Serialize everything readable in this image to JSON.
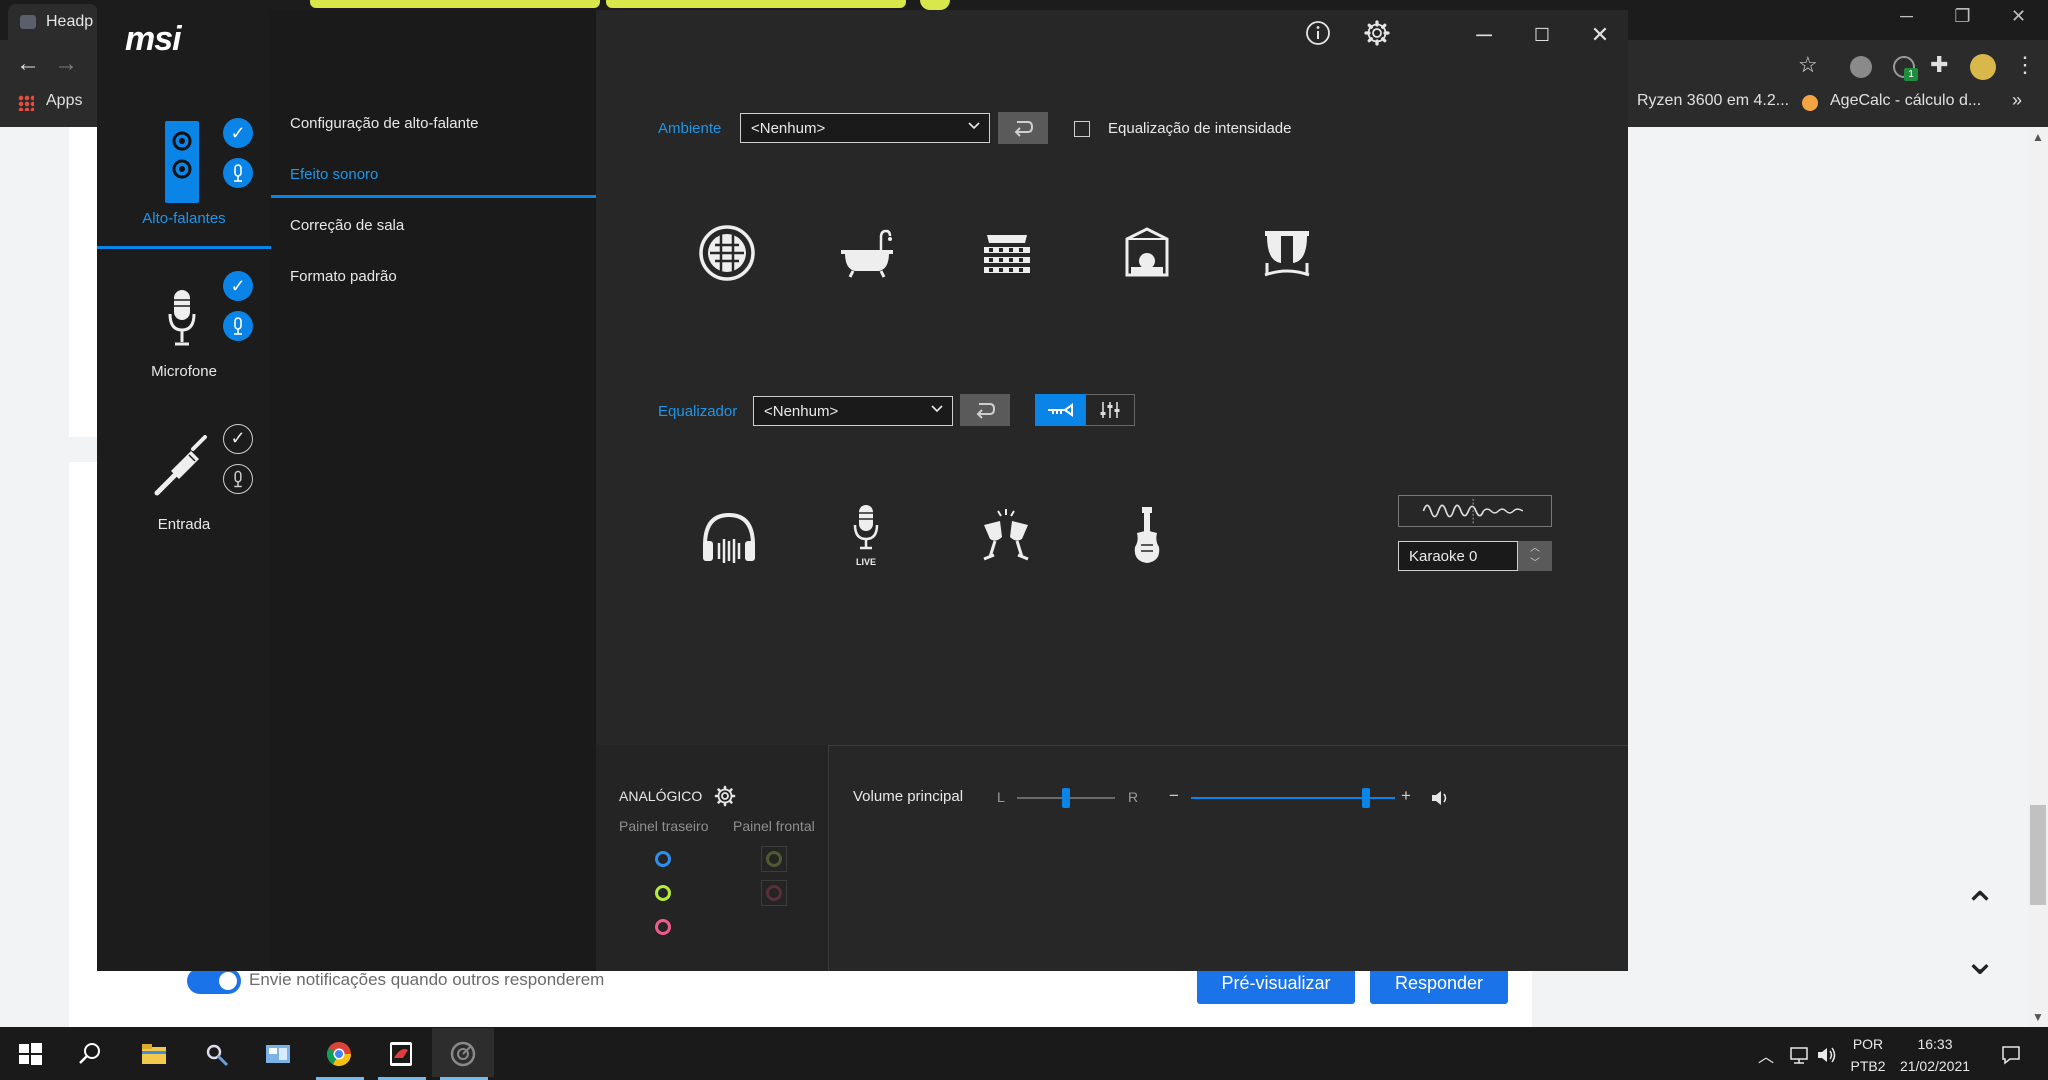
{
  "browser": {
    "tab_title": "Headp",
    "bookmarks": {
      "apps_label": "Apps",
      "ryzen_label": "Ryzen 3600 em 4.2...",
      "agecalc_label": "AgeCalc - cálculo d..."
    },
    "more_bookmarks": "»",
    "ext_count": "1"
  },
  "page": {
    "notify_label": "Envie notificações quando outros responderem",
    "preview_button": "Pré-visualizar",
    "reply_button": "Responder"
  },
  "app": {
    "logo": "msi",
    "devices": [
      {
        "label": "Alto-falantes"
      },
      {
        "label": "Microfone"
      },
      {
        "label": "Entrada"
      }
    ],
    "menu": [
      {
        "label": "Configuração de alto-falante"
      },
      {
        "label": "Efeito sonoro"
      },
      {
        "label": "Correção de sala"
      },
      {
        "label": "Formato padrão"
      }
    ],
    "environment": {
      "label": "Ambiente",
      "value": "<Nenhum>",
      "loudness_label": "Equalização de intensidade"
    },
    "equalizer": {
      "label": "Equalizador",
      "value": "<Nenhum>",
      "live_text": "LIVE"
    },
    "karaoke": {
      "value": "Karaoke 0"
    },
    "bottom": {
      "analog_label": "ANALÓGICO",
      "rear_panel": "Painel traseiro",
      "front_panel": "Painel frontal",
      "volume_label": "Volume principal",
      "balance_left": "L",
      "balance_right": "R",
      "vol_minus": "−",
      "vol_plus": "+"
    },
    "colors": {
      "accent": "#0a84e6",
      "jack_blue": "#2f8fef",
      "jack_green": "#b6ec3a",
      "jack_pink": "#ef5b8e",
      "jack_front_green": "#4e5a2f",
      "jack_front_red": "#5a2f3a"
    }
  },
  "taskbar": {
    "lang": "POR",
    "layout": "PTB2",
    "time": "16:33",
    "date": "21/02/2021"
  }
}
